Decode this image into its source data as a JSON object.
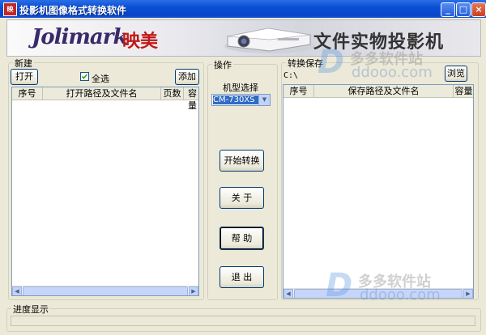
{
  "window": {
    "title": "投影机图像格式转换软件",
    "app_icon_label": "映",
    "minimize": "_",
    "maximize": "□",
    "close": "×"
  },
  "banner": {
    "logo_en": "Jolimark",
    "logo_cn": "映美",
    "title": "文件实物投影机"
  },
  "new_group": {
    "label": "新建",
    "open_button": "打开",
    "select_all_label": "全选",
    "select_all_checked": true,
    "add_button": "添加",
    "columns": [
      "序号",
      "打开路径及文件名",
      "页数",
      "容量"
    ],
    "rows": []
  },
  "operation_group": {
    "label": "操作",
    "model_label": "机型选择",
    "model_value": "CM-730XS",
    "start_button": "开始转换",
    "about_button": "关 于",
    "help_button": "帮 助",
    "exit_button": "退 出"
  },
  "save_group": {
    "label": "转换保存",
    "path_value": "C:\\",
    "browse_button": "浏览",
    "columns": [
      "序号",
      "保存路径及文件名",
      "容量"
    ],
    "rows": []
  },
  "progress_group": {
    "label": "进度显示",
    "progress": 0
  },
  "watermarks": {
    "brand_cn": "多多软件站",
    "url": "ddooo.com",
    "letter": "D"
  },
  "colors": {
    "titlebar": "#0a4fd6",
    "dialog_bg": "#ece9d8",
    "logo_red": "#c01818",
    "logo_purple": "#3a2a6a"
  }
}
